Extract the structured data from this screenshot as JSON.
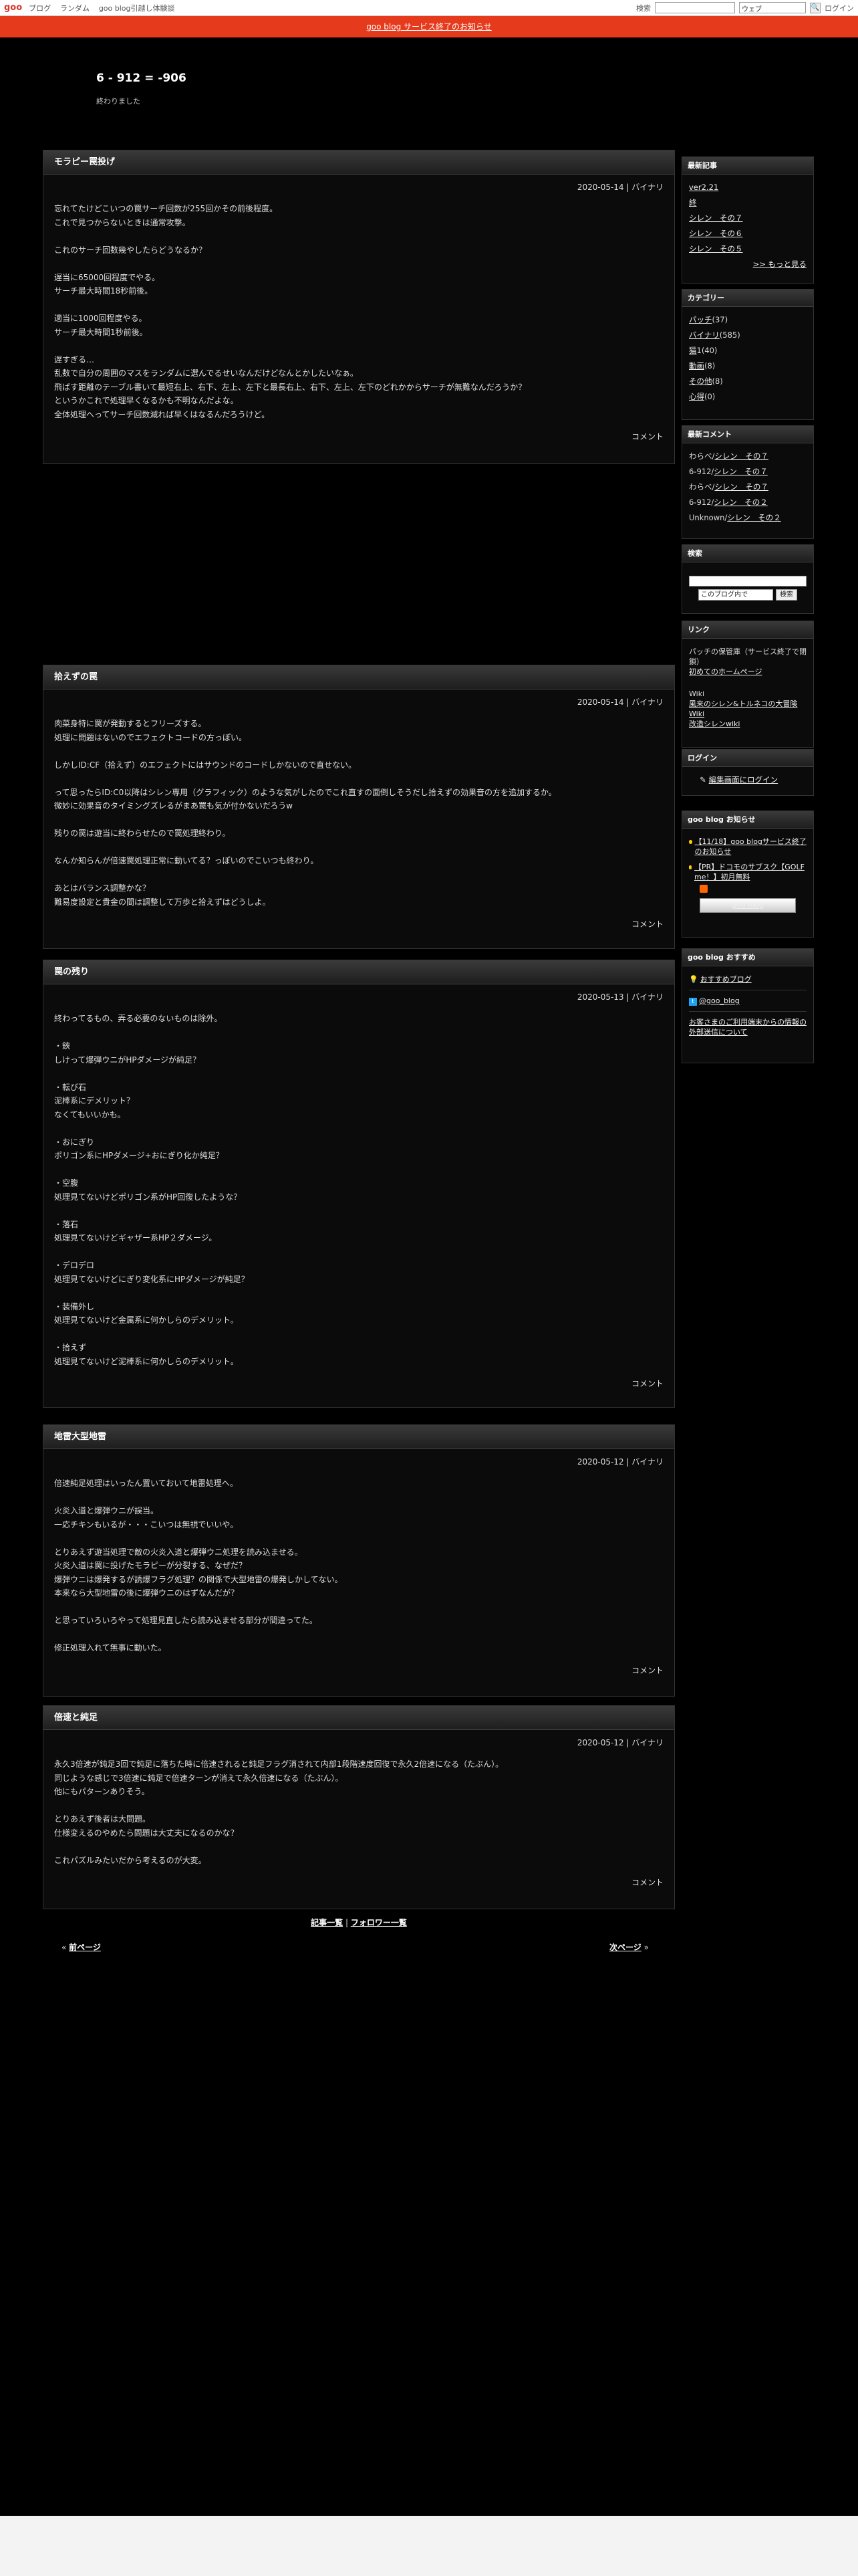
{
  "topbar": {
    "logo": "goo",
    "links": [
      "ブログ",
      "ランダム",
      "goo blog引越し体験談"
    ],
    "search_label": "検索",
    "search_select": "ウェブ",
    "search_go": "🔍",
    "login": "ログイン"
  },
  "notice": "goo blog サービス終了のお知らせ",
  "header": {
    "title": "6 - 912 = -906",
    "description": "終わりました"
  },
  "entries": [
    {
      "title": "モラピー罠投げ",
      "meta": "2020-05-14 | バイナリ",
      "body": "忘れてたけどこいつの罠サーチ回数が255回かその前後程度。\nこれで見つからないときは通常攻撃。\n\nこれのサーチ回数幾やしたらどうなるか？\n\n遅当に65000回程度でやる。\nサーチ最大時間18秒前後。\n\n適当に1000回程度やる。\nサーチ最大時間1秒前後。\n\n遅すぎる…\n乱数で自分の周囲のマスをランダムに選んでるせいなんだけどなんとかしたいなぁ。\n飛ばす距離のテーブル書いて最短右上、右下、左上、左下と最長右上、右下、左上、左下のどれかからサーチが無難なんだろうか？\nというかこれで処理早くなるかも不明なんだよな。\n全体処理へってサーチ回数減れば早くはなるんだろうけど。",
      "comment": "コメント"
    },
    {
      "title": "拾えずの罠",
      "meta": "2020-05-14 | バイナリ",
      "body": "肉菜身特に罠が発動するとフリーズする。\n処理に問題はないのでエフェクトコードの方っぽい。\n\nしかしID:CF（拾えず）のエフェクトにはサウンドのコードしかないので直せない。\n\nって思ったらID:C0以降はシレン専用（グラフィック）のような気がしたのでこれ直すの面倒しそうだし拾えずの効果音の方を追加するか。\n微妙に効果音のタイミングズレるがまあ罠も気が付かないだろうw\n\n残りの罠は遊当に終わらせたので罠処理終わり。\n\nなんか知らんが倍速罠処理正常に動いてる？っぽいのでこいつも終わり。\n\nあとはバランス調整かな？\n難易度設定と貴金の間は調整して万歩と拾えずはどうしよ。",
      "comment": "コメント"
    },
    {
      "title": "罠の残り",
      "meta": "2020-05-13 | バイナリ",
      "body": "終わってるもの、弄る必要のないものは除外。\n\n・鋏\nしけって爆弾ウニがHPダメージが純足？\n\n・転び石\n泥棒系にデメリット？\nなくてもいいかも。\n\n・おにぎり\nポリゴン系にHPダメージ+おにぎり化か純足？\n\n・空腹\n処理見てないけどポリゴン系がHP回復したような？\n\n・落石\n処理見てないけどギャザー系HP２ダメージ。\n\n・デロデロ\n処理見てないけどにぎり変化系にHPダメージが純足？\n\n・装備外し\n処理見てないけど金属系に何かしらのデメリット。\n\n・拾えず\n処理見てないけど泥棒系に何かしらのデメリット。",
      "comment": "コメント"
    },
    {
      "title": "地雷大型地雷",
      "meta": "2020-05-12 | バイナリ",
      "body": "倍速純足処理はいったん置いておいて地雷処理へ。\n\n火炎入道と爆弾ウニが誤当。\n一応チキンもいるが・・・こいつは無視でいいや。\n\nとりあえず遊当処理で敵の火炎入道と爆弾ウニ処理を読み込ませる。\n火炎入道は罠に投げたモラピーが分裂する、なぜだ？\n爆弾ウニは爆発するが誘爆フラグ処理？の関係で大型地雷の爆発しかしてない。\n本来なら大型地雷の後に爆弾ウニのはずなんだが？\n\nと思っていろいろやって処理見直したら読み込ませる部分が間違ってた。\n\n修正処理入れて無事に動いた。",
      "comment": "コメント"
    },
    {
      "title": "倍速と純足",
      "meta": "2020-05-12 | バイナリ",
      "body": "永久3倍速が鈍足3回で鈍足に落ちた時に倍速されると鈍足フラグ消されて内部1段階速度回復で永久2倍速になる（たぶん）。\n同じような感じで3倍速に鈍足で倍速ターンが消えて永久倍速になる（たぶん）。\n他にもパターンありそう。\n\nとりあえず後者は大問題。\n仕様変えるのやめたら問題は大丈夫になるのかな？\n\nこれパズルみたいだから考えるのが大変。",
      "comment": "コメント"
    }
  ],
  "pager": {
    "list": "記事一覧",
    "sep": "|",
    "follow": "フォロワー一覧",
    "prev_mark": "«",
    "prev": "前ページ",
    "next": "次ページ",
    "next_mark": "»"
  },
  "sidebar": {
    "recent": {
      "title": "最新記事",
      "items": [
        "ver2.21",
        "終",
        "シレン　その７",
        "シレン　その６",
        "シレン　その５"
      ],
      "more": ">> もっと見る"
    },
    "category": {
      "title": "カテゴリー",
      "items": [
        {
          "name": "パッチ",
          "count": "(37)"
        },
        {
          "name": "バイナリ",
          "count": "(585)"
        },
        {
          "name": "猫",
          "count": "1(40)"
        },
        {
          "name": "動画",
          "count": "(8)"
        },
        {
          "name": "その他",
          "count": "(8)"
        },
        {
          "name": "心得",
          "count": "(0)"
        }
      ]
    },
    "comments": {
      "title": "最新コメント",
      "items": [
        {
          "who": "わらべ/",
          "post": "シレン　その７"
        },
        {
          "who": "6-912/",
          "post": "シレン　その７"
        },
        {
          "who": "わらべ/",
          "post": "シレン　その７"
        },
        {
          "who": "6-912/",
          "post": "シレン　その２"
        },
        {
          "who": "Unknown/",
          "post": "シレン　その２"
        }
      ]
    },
    "search": {
      "title": "検索",
      "scope": "このブログ内で",
      "button": "検索"
    },
    "links": {
      "title": "リンク",
      "note1": "パッチの保管庫（サービス終了で閉鎖）",
      "link1": "初めてのホームページ",
      "note2": "Wiki",
      "link2": "風来のシレン&トルネコの大冒険 Wiki",
      "link3": "改造シレンwiki"
    },
    "login": {
      "title": "ログイン",
      "link": "編集画面にログイン"
    },
    "news": {
      "title": "goo blog お知らせ",
      "items": [
        "【11/18】goo blogサービス終了のお知らせ",
        "【PR】ドコモのサブスク【GOLF me！】初月無料"
      ],
      "rss": "RSS",
      "goo": "goo blog"
    },
    "recommend": {
      "title": "goo blog おすすめ",
      "blog": "おすすめブログ",
      "twitter": "@goo_blog",
      "privacy": "お客さまのご利用端末からの情報の外部送信について"
    }
  },
  "colors": {
    "notice_bg": "#e63a1d",
    "background": "#000000",
    "box_border": "#333333"
  }
}
